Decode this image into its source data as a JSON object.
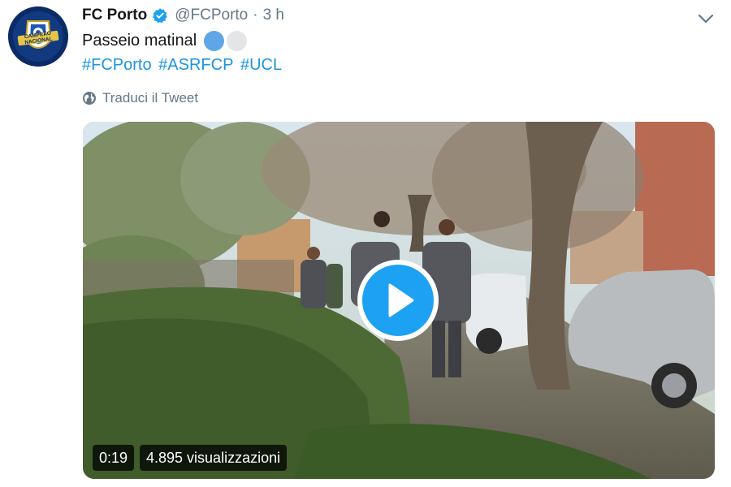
{
  "author": {
    "display_name": "FC Porto",
    "handle": "@FCPorto",
    "separator": "·",
    "timestamp": "3 h",
    "verified": true,
    "avatar_text_top": "CAMPEÃO",
    "avatar_text_bottom": "NACIONAL"
  },
  "tweet": {
    "text": "Passeio matinal",
    "emojis": [
      "blue-circle",
      "white-circle"
    ],
    "hashtags": [
      "#FCPorto",
      "#ASRFCP",
      "#UCL"
    ],
    "translate_label": "Traduci il Tweet"
  },
  "media": {
    "type": "video",
    "duration": "0:19",
    "views": "4.895 visualizzazioni"
  },
  "colors": {
    "accent": "#1da1f2",
    "link": "#1b95e0",
    "secondary_text": "#657786",
    "primary_text": "#14171a"
  },
  "icons": [
    "verified-badge-icon",
    "chevron-down-icon",
    "globe-icon",
    "play-icon"
  ]
}
